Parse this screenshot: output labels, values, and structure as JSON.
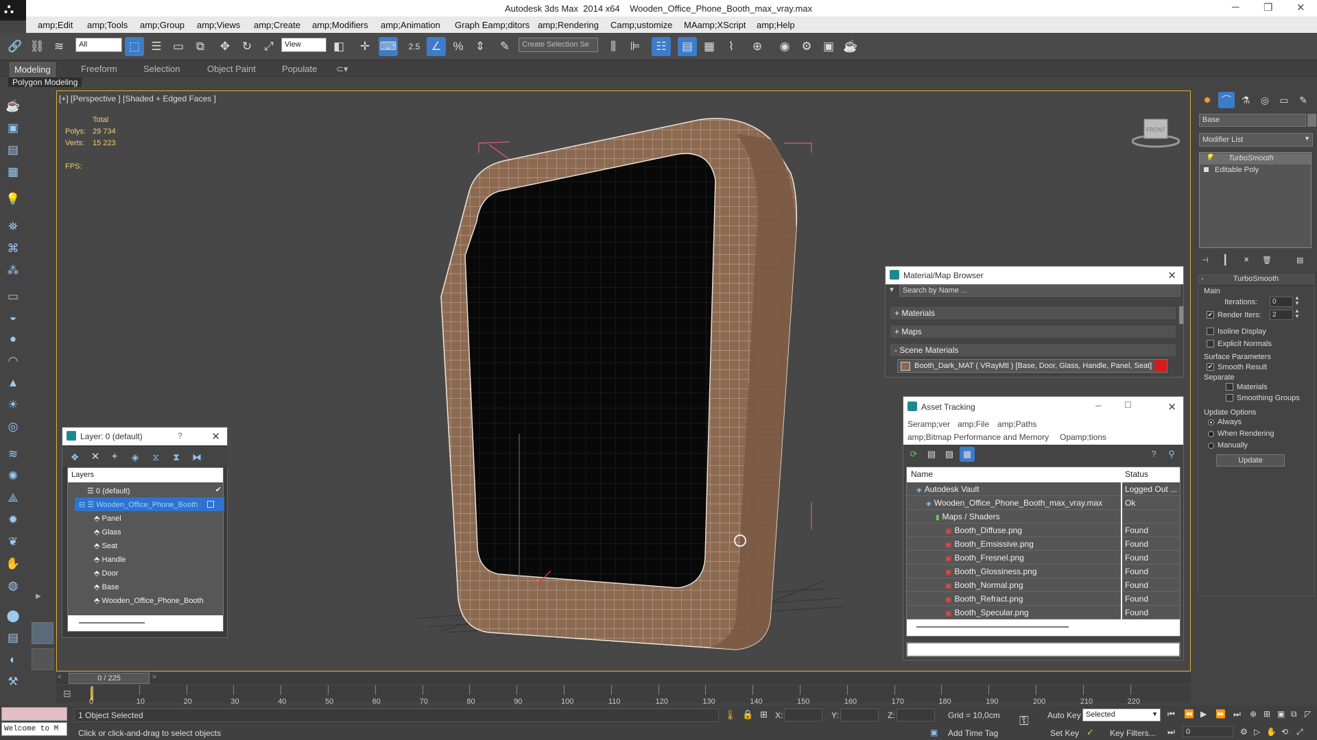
{
  "window": {
    "title": "Autodesk 3ds Max  2014 x64    Wooden_Office_Phone_Booth_max_vray.max"
  },
  "menu": [
    "amp;Edit",
    "amp;Tools",
    "amp;Group",
    "amp;Views",
    "amp;Create",
    "amp;Modifiers",
    "amp;Animation",
    "Graph Eamp;ditors",
    "amp;Rendering",
    "Camp;ustomize",
    "MAamp;XScript",
    "amp;Help"
  ],
  "toolbar": {
    "filter_value": "All",
    "refcoord_value": "View",
    "named_selection_placeholder": "Create Selection Se",
    "snap_value": "2.5"
  },
  "ribbon": {
    "tabs": [
      "Modeling",
      "Freeform",
      "Selection",
      "Object Paint",
      "Populate"
    ],
    "subtab": "Polygon Modeling"
  },
  "viewport": {
    "label": "[+] [Perspective ] [Shaded + Edged Faces ]",
    "stats": {
      "total_label": "Total",
      "polys_label": "Polys:",
      "polys": "29 734",
      "verts_label": "Verts:",
      "verts": "15 223",
      "fps_label": "FPS:"
    },
    "cube_label": "FRONT"
  },
  "layer_panel": {
    "title": "Layer: 0 (default)",
    "help": "?",
    "header": "Layers",
    "rows": [
      "0 (default)",
      "Wooden_Office_Phone_Booth",
      "Panel",
      "Glass",
      "Seat",
      "Handle",
      "Door",
      "Base",
      "Wooden_Office_Phone_Booth"
    ]
  },
  "material_browser": {
    "title": "Material/Map Browser",
    "search_placeholder": "Search by Name ...",
    "sections": [
      "+ Materials",
      "+ Maps",
      "- Scene Materials"
    ],
    "material": "Booth_Dark_MAT  ( VRayMtl )  [Base, Door, Glass, Handle, Panel, Seat]"
  },
  "asset_tracking": {
    "title": "Asset Tracking",
    "menu1": [
      "Seramp;ver",
      "amp;File",
      "amp;Paths"
    ],
    "menu2": [
      "amp;Bitmap Performance and Memory",
      "Opamp;tions"
    ],
    "columns": [
      "Name",
      "Status"
    ],
    "rows": [
      {
        "name": "Autodesk Vault",
        "status": "Logged Out ...",
        "indent": 1
      },
      {
        "name": "Wooden_Office_Phone_Booth_max_vray.max",
        "status": "Ok",
        "indent": 2
      },
      {
        "name": "Maps / Shaders",
        "status": "",
        "indent": 3
      },
      {
        "name": "Booth_Diffuse.png",
        "status": "Found",
        "indent": 4
      },
      {
        "name": "Booth_Emsissive.png",
        "status": "Found",
        "indent": 4
      },
      {
        "name": "Booth_Fresnel.png",
        "status": "Found",
        "indent": 4
      },
      {
        "name": "Booth_Glossiness.png",
        "status": "Found",
        "indent": 4
      },
      {
        "name": "Booth_Normal.png",
        "status": "Found",
        "indent": 4
      },
      {
        "name": "Booth_Refract.png",
        "status": "Found",
        "indent": 4
      },
      {
        "name": "Booth_Specular.png",
        "status": "Found",
        "indent": 4
      }
    ]
  },
  "command_panel": {
    "object_name": "Base",
    "modifier_list": "Modifier List",
    "stack": [
      "TurboSmooth",
      "Editable Poly"
    ],
    "rollout_title": "TurboSmooth",
    "main_label": "Main",
    "iterations_label": "Iterations:",
    "iterations": "0",
    "render_iters_label": "Render Iters:",
    "render_iters": "2",
    "isoline": "Isoline Display",
    "explicit": "Explicit Normals",
    "surface_label": "Surface Parameters",
    "smooth_result": "Smooth Result",
    "separate_label": "Separate",
    "materials": "Materials",
    "smoothing_groups": "Smoothing Groups",
    "update_label": "Update Options",
    "always": "Always",
    "when_rendering": "When Rendering",
    "manually": "Manually",
    "update_button": "Update"
  },
  "timeline": {
    "frame_display": "0 / 225",
    "ticks": [
      "0",
      "10",
      "20",
      "30",
      "40",
      "50",
      "60",
      "70",
      "80",
      "90",
      "100",
      "110",
      "120",
      "130",
      "140",
      "150",
      "160",
      "170",
      "180",
      "190",
      "200",
      "210",
      "220"
    ]
  },
  "status": {
    "maxscript": "Welcome to M",
    "selected": "1 Object Selected",
    "prompt": "Click or click-and-drag to select objects",
    "x_label": "X:",
    "y_label": "Y:",
    "z_label": "Z:",
    "grid": "Grid = 10,0cm",
    "add_time_tag": "Add Time Tag",
    "auto_key": "Auto Key",
    "set_key": "Set Key",
    "selected_dropdown": "Selected",
    "key_filters": "Key Filters...",
    "frame": "0"
  }
}
